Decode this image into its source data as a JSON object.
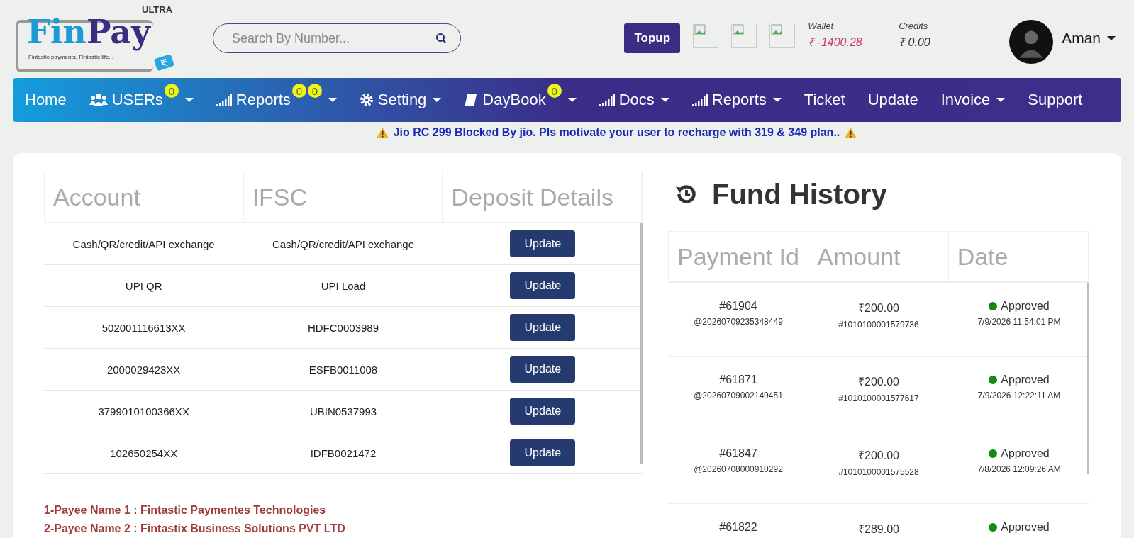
{
  "logo": {
    "word_1": "Fin",
    "word_2": "Pay",
    "tier": "ULTRA",
    "tagline": "Fintastic payments, Fintastic life..."
  },
  "search": {
    "placeholder": "Search By Number..."
  },
  "topup_button": "Topup",
  "wallet": {
    "label": "Wallet",
    "value": "₹ -1400.28"
  },
  "credits": {
    "label": "Credits",
    "value": "₹ 0.00"
  },
  "user": {
    "name": "Aman"
  },
  "nav": [
    {
      "label": "Home",
      "kind": "plain",
      "dropdown": false
    },
    {
      "label": "USERs",
      "kind": "users",
      "dropdown": true,
      "badges": [
        "0"
      ]
    },
    {
      "label": "Reports",
      "kind": "bars",
      "dropdown": true,
      "badges": [
        "0",
        "0"
      ]
    },
    {
      "label": "Setting",
      "kind": "gear",
      "dropdown": true
    },
    {
      "label": "DayBook",
      "kind": "book",
      "dropdown": true,
      "badges": [
        "0"
      ]
    },
    {
      "label": "Docs",
      "kind": "bars",
      "dropdown": true
    },
    {
      "label": "Reports",
      "kind": "bars",
      "dropdown": true
    },
    {
      "label": "Ticket",
      "kind": "plain",
      "dropdown": false
    },
    {
      "label": "Update",
      "kind": "plain",
      "dropdown": false
    },
    {
      "label": "Invoice",
      "kind": "plain",
      "dropdown": true
    },
    {
      "label": "Support",
      "kind": "plain",
      "dropdown": false
    }
  ],
  "alert": "Jio RC 299 Blocked By jio. Pls motivate your user to recharge with 319 & 349 plan..",
  "accounts": {
    "columns": [
      "Account",
      "IFSC",
      "Deposit Details"
    ],
    "rows": [
      {
        "account": "Cash/QR/credit/API exchange",
        "ifsc": "Cash/QR/credit/API exchange",
        "action": "Update"
      },
      {
        "account": "UPI QR",
        "ifsc": "UPI Load",
        "action": "Update"
      },
      {
        "account": "502001116613XX",
        "ifsc": "HDFC0003989",
        "action": "Update"
      },
      {
        "account": "2000029423XX",
        "ifsc": "ESFB0011008",
        "action": "Update"
      },
      {
        "account": "3799010100366XX",
        "ifsc": "UBIN0537993",
        "action": "Update"
      },
      {
        "account": "102650254XX",
        "ifsc": "IDFB0021472",
        "action": "Update"
      }
    ]
  },
  "payees": [
    "1-Payee Name 1 : Fintastic Paymentes Technologies",
    "2-Payee Name 2 : Fintastix Business Solutions PVT LTD"
  ],
  "fund_history": {
    "title": "Fund History",
    "columns": [
      "Payment Id",
      "Amount",
      "Date"
    ],
    "rows": [
      {
        "id": "#61904",
        "ref": "@20260709235348449",
        "amount": "₹200.00",
        "txn": "#1010100001579736",
        "status": "Approved",
        "color": "#138a13",
        "date": "7/9/2026 11:54:01 PM"
      },
      {
        "id": "#61871",
        "ref": "@20260709002149451",
        "amount": "₹200.00",
        "txn": "#1010100001577617",
        "status": "Approved",
        "color": "#138a13",
        "date": "7/9/2026 12:22:11 AM"
      },
      {
        "id": "#61847",
        "ref": "@20260708000910292",
        "amount": "₹200.00",
        "txn": "#1010100001575528",
        "status": "Approved",
        "color": "#138a13",
        "date": "7/8/2026 12:09:26 AM"
      },
      {
        "id": "#61822",
        "amount": "₹289.00",
        "status": "Approved",
        "color": "#138a13"
      }
    ]
  }
}
